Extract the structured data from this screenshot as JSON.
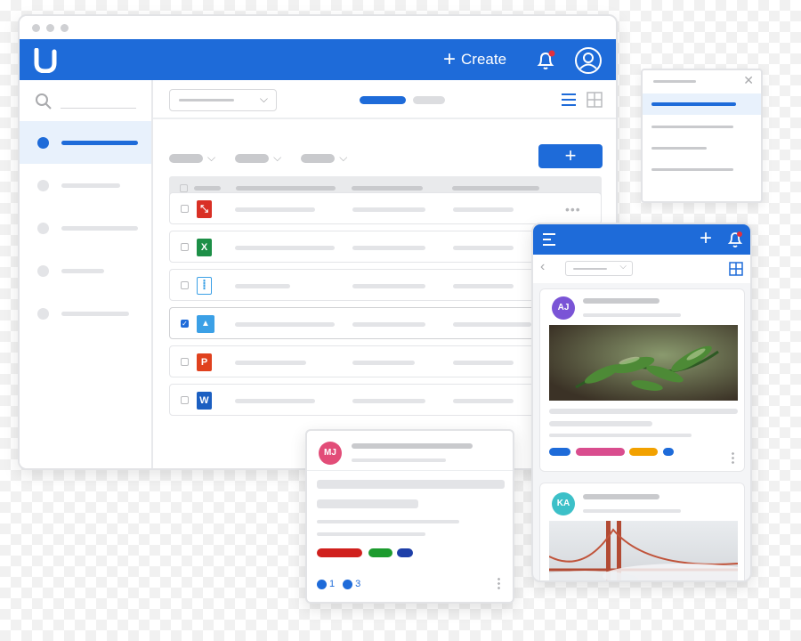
{
  "header": {
    "create_label": "Create"
  },
  "file_types": [
    "PDF",
    "Excel",
    "Zip",
    "Image",
    "PowerPoint",
    "Word"
  ],
  "file_icon_glyphs": [
    "⤡",
    "X",
    "┋",
    "▲",
    "P",
    "W"
  ],
  "mobile_posts": [
    {
      "initials": "AJ"
    },
    {
      "initials": "KA"
    }
  ],
  "card": {
    "initials": "MJ",
    "count_one": "1",
    "count_two": "3"
  },
  "colors": {
    "primary": "#1e6bd9",
    "pdf": "#d93025",
    "excel": "#1d8f47",
    "image": "#3ba0e6",
    "powerpoint": "#e0411e",
    "word": "#1b5fc1",
    "aj": "#7a54d6",
    "ka": "#3cc0c8",
    "mj": "#e24d78",
    "tag_blue": "#1e6bd9",
    "tag_pink": "#d94d8e",
    "tag_orange": "#f2a100",
    "tag_red": "#d0201d",
    "tag_green": "#1c9b2e"
  }
}
